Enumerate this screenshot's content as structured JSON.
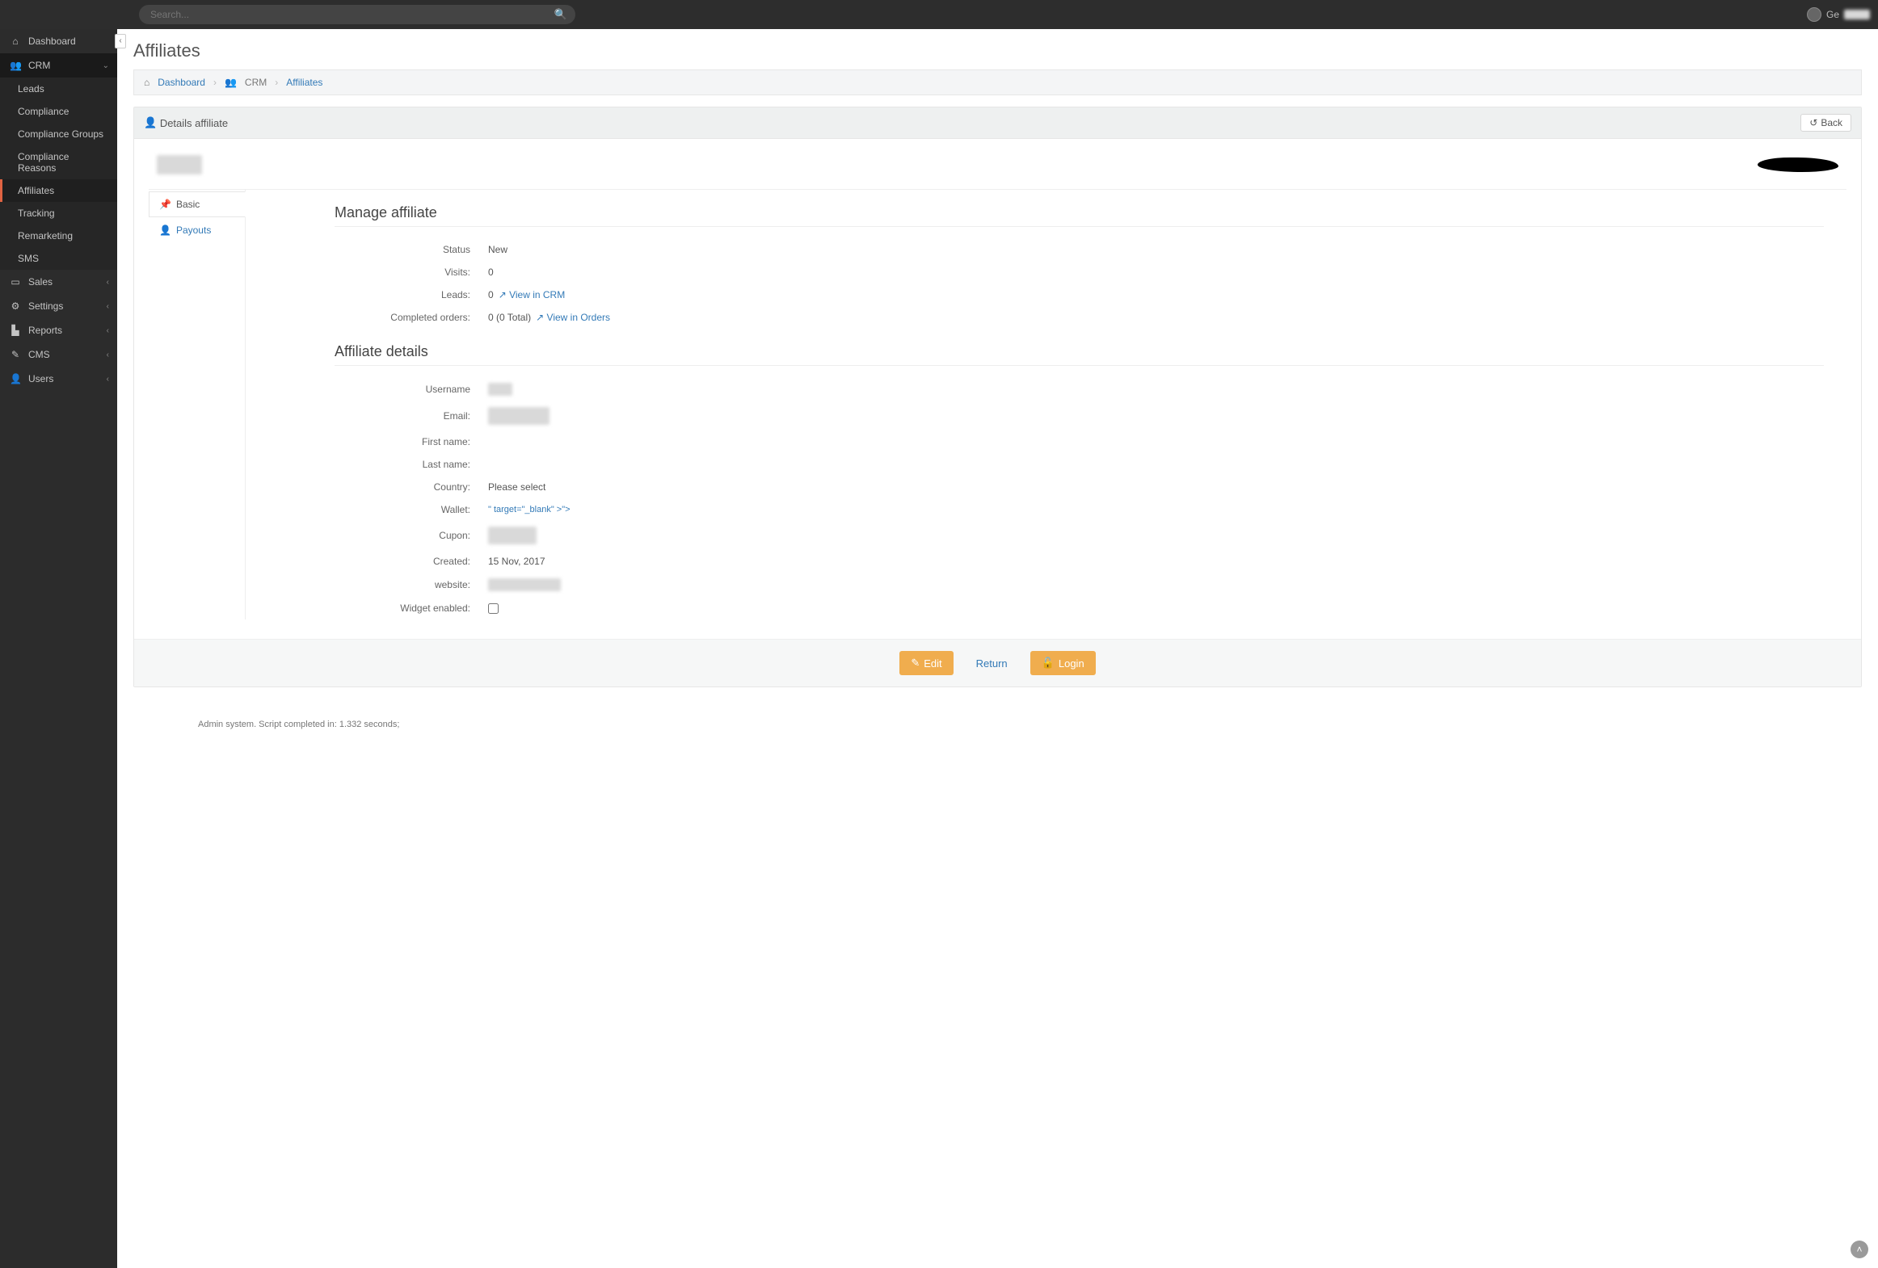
{
  "topbar": {
    "search_placeholder": "Search...",
    "user_label_prefix": "Ge"
  },
  "sidebar": {
    "dashboard": "Dashboard",
    "crm": "CRM",
    "crm_sub": {
      "leads": "Leads",
      "compliance": "Compliance",
      "compliance_groups": "Compliance   Groups",
      "compliance_reasons": "Compliance   Reasons",
      "affiliates": "Affiliates",
      "tracking": "Tracking",
      "remarketing": "Remarketing",
      "sms": "SMS"
    },
    "sales": "Sales",
    "settings": "Settings",
    "reports": "Reports",
    "cms": "CMS",
    "users": "Users"
  },
  "page": {
    "title": "Affiliates",
    "breadcrumb": {
      "dashboard": "Dashboard",
      "crm": "CRM",
      "current": "Affiliates"
    }
  },
  "panel": {
    "head_label": "Details  affiliate",
    "back_label": "Back",
    "tabs": {
      "basic": "Basic",
      "payouts": "Payouts"
    },
    "section_manage": "Manage   affiliate",
    "section_details": "Affiliate details",
    "manage": {
      "status_label": "Status",
      "status_value": "New",
      "visits_label": "Visits:",
      "visits_value": "0",
      "leads_label": "Leads:",
      "leads_value": "0",
      "leads_link": "View in CRM",
      "orders_label": "Completed   orders:",
      "orders_value": "0 (0 Total)",
      "orders_link": "View in Orders"
    },
    "details": {
      "username_label": "Username",
      "email_label": "Email:",
      "firstname_label": "First  name:",
      "firstname_value": "",
      "lastname_label": "Last  name:",
      "lastname_value": "",
      "country_label": "Country:",
      "country_value": "Please   select",
      "wallet_label": "Wallet:",
      "wallet_value": "\" target=\"_blank\"  >\">",
      "cupon_label": "Cupon:",
      "created_label": "Created:",
      "created_value": "15 Nov, 2017",
      "website_label": "website:",
      "widget_label": "Widget  enabled:"
    },
    "foot": {
      "edit": "Edit",
      "return": "Return",
      "login": "Login"
    }
  },
  "footer": {
    "note": "Admin system.   Script  completed   in: 1.332  seconds;"
  }
}
